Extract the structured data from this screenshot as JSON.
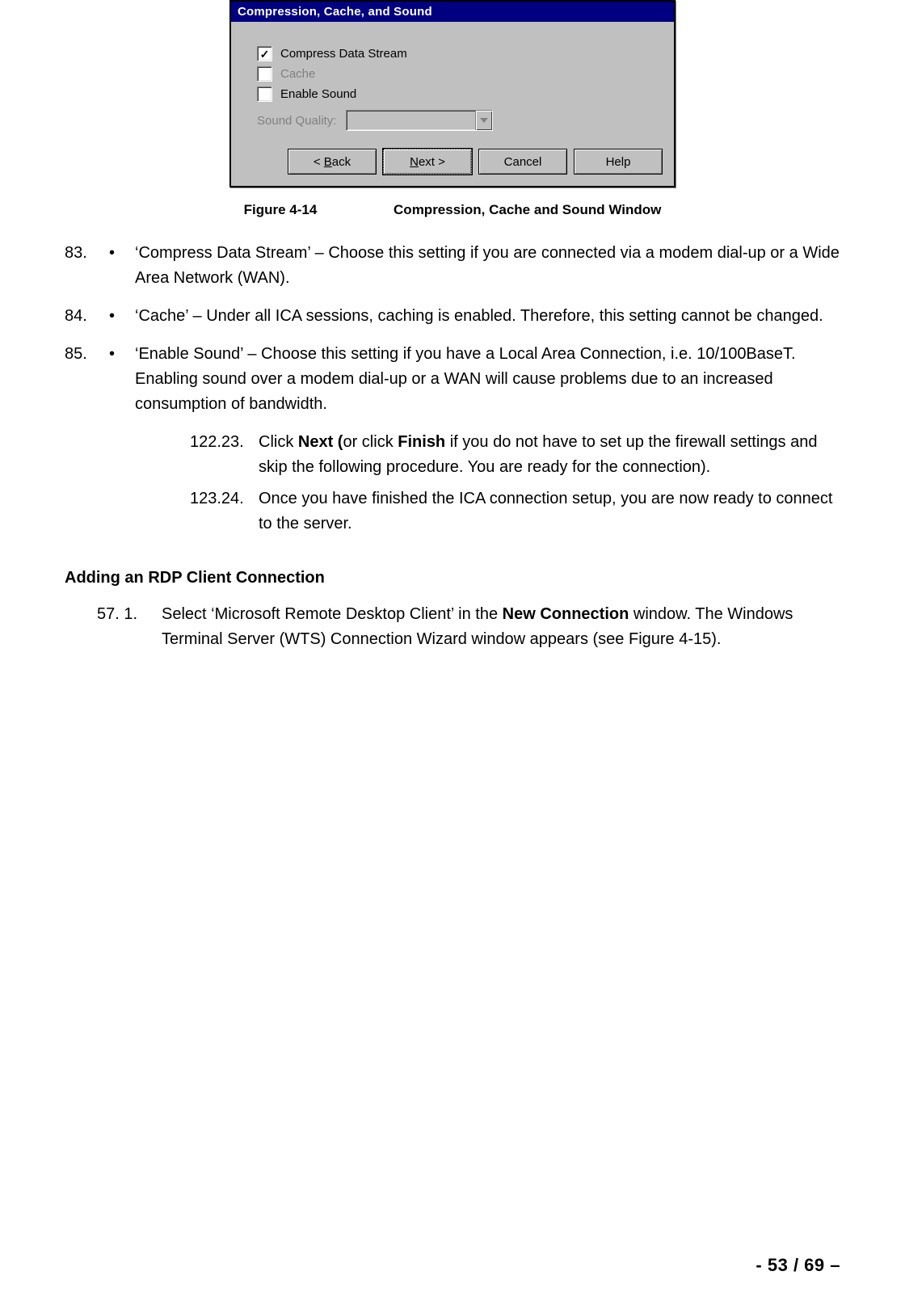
{
  "dialog": {
    "title": "Compression, Cache, and Sound",
    "compress_label": "Compress Data Stream",
    "compress_checked": true,
    "cache_label": "Cache",
    "cache_checked": false,
    "cache_enabled": false,
    "enable_sound_label": "Enable Sound",
    "enable_sound_checked": false,
    "sound_quality_label": "Sound Quality:",
    "sound_quality_value": "",
    "back_label": "< Back",
    "next_label": "Next >",
    "cancel_label": "Cancel",
    "help_label": "Help"
  },
  "caption": {
    "label": "Figure 4-14",
    "text": "Compression, Cache and Sound Window"
  },
  "bullets": [
    {
      "num": "83.",
      "text": "‘Compress Data Stream’ – Choose this setting if you are connected via a modem dial-up or a Wide Area Network (WAN)."
    },
    {
      "num": "84.",
      "text": "‘Cache’ – Under all ICA sessions, caching is enabled.  Therefore, this setting cannot be changed."
    },
    {
      "num": "85.",
      "text": "‘Enable Sound’ – Choose this setting if you have a Local Area Connection, i.e. 10/100BaseT.  Enabling sound over a modem dial-up or a WAN will cause problems due to an increased consumption of bandwidth."
    }
  ],
  "substeps": [
    {
      "num": "122.23.",
      "pre": "Click ",
      "b1": "Next (",
      "mid": "or click ",
      "b2": "Finish",
      "post": " if you do not have to set up the firewall settings and skip the following procedure.  You are ready for the connection)."
    },
    {
      "num": "123.24.",
      "text": "Once you have finished the ICA connection setup, you are now ready to connect to the server."
    }
  ],
  "section_head": "Adding an RDP Client Connection",
  "rdp_step": {
    "num": "57. 1.",
    "pre": "Select ‘Microsoft Remote Desktop Client’ in the ",
    "b1": "New Connection",
    "post": " window.   The Windows Terminal Server (WTS) Connection Wizard window appears (see Figure 4-15)."
  },
  "footer": "- 53 / 69 –"
}
